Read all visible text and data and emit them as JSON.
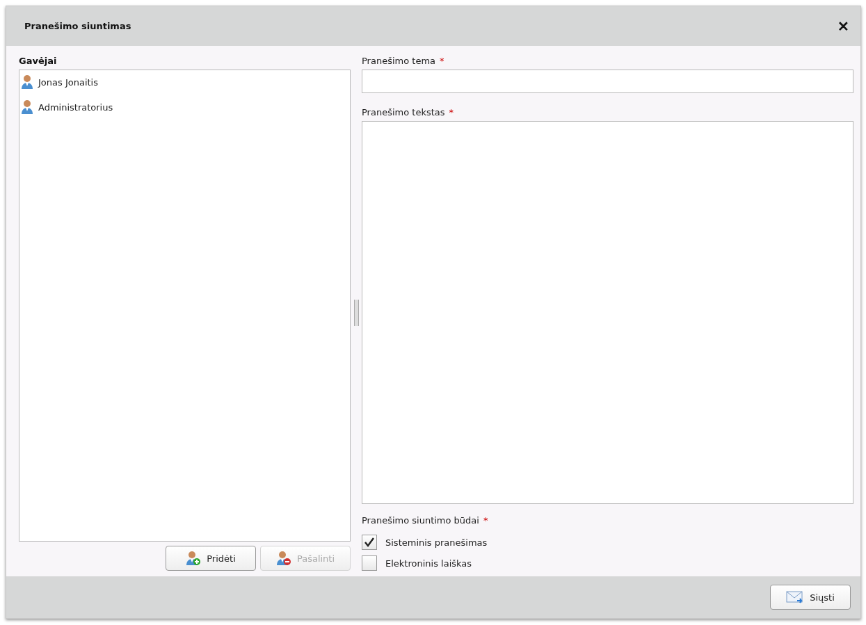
{
  "window": {
    "title": "Pranešimo siuntimas",
    "close": "✕"
  },
  "recipients": {
    "label": "Gavėjai",
    "items": [
      {
        "name": "Jonas Jonaitis"
      },
      {
        "name": "Administratorius"
      }
    ],
    "buttons": [
      {
        "label": "Pridėti",
        "kind": "add",
        "disabled": false
      },
      {
        "label": "Pašalinti",
        "kind": "remove",
        "disabled": true
      }
    ]
  },
  "subject": {
    "label": "Pranešimo tema",
    "required": "*"
  },
  "text": {
    "label": "Pranešimo tekstas",
    "required": "*"
  },
  "methods": {
    "label": "Pranešimo siuntimo būdai",
    "required": "*",
    "options": [
      {
        "label": "Sisteminis pranešimas",
        "checked": true
      },
      {
        "label": "Elektroninis laiškas",
        "checked": false
      }
    ]
  },
  "footer": {
    "send": "Siųsti"
  }
}
